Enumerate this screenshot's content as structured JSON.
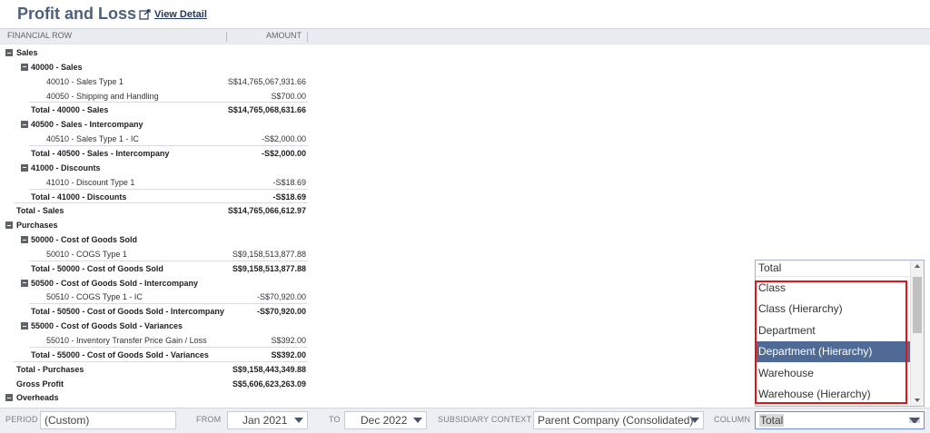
{
  "header": {
    "title": "Profit and Loss",
    "view_detail_label": "View Detail"
  },
  "table": {
    "col_financial_row": "FINANCIAL ROW",
    "col_amount": "AMOUNT"
  },
  "rows": [
    {
      "label": "Sales",
      "amount": "",
      "level": 0,
      "bold": true,
      "toggle": true
    },
    {
      "label": "40000 - Sales",
      "amount": "",
      "level": 1,
      "bold": true,
      "toggle": true
    },
    {
      "label": "40010 - Sales Type 1",
      "amount": "S$14,765,067,931.66",
      "level": 2,
      "bold": false
    },
    {
      "label": "40050 - Shipping and Handling",
      "amount": "S$700.00",
      "level": 2,
      "bold": false
    },
    {
      "label": "Total - 40000 - Sales",
      "amount": "S$14,765,068,631.66",
      "level": 1,
      "bold": true,
      "total": true
    },
    {
      "label": "40500 - Sales - Intercompany",
      "amount": "",
      "level": 1,
      "bold": true,
      "toggle": true
    },
    {
      "label": "40510 - Sales Type 1 - IC",
      "amount": "-S$2,000.00",
      "level": 2,
      "bold": false
    },
    {
      "label": "Total - 40500 - Sales - Intercompany",
      "amount": "-S$2,000.00",
      "level": 1,
      "bold": true,
      "total": true
    },
    {
      "label": "41000 - Discounts",
      "amount": "",
      "level": 1,
      "bold": true,
      "toggle": true
    },
    {
      "label": "41010 - Discount Type 1",
      "amount": "-S$18.69",
      "level": 2,
      "bold": false
    },
    {
      "label": "Total - 41000 - Discounts",
      "amount": "-S$18.69",
      "level": 1,
      "bold": true,
      "total": true
    },
    {
      "label": "Total - Sales",
      "amount": "S$14,765,066,612.97",
      "level": 0,
      "bold": true,
      "total": true
    },
    {
      "label": "Purchases",
      "amount": "",
      "level": 0,
      "bold": true,
      "toggle": true
    },
    {
      "label": "50000 - Cost of Goods Sold",
      "amount": "",
      "level": 1,
      "bold": true,
      "toggle": true
    },
    {
      "label": "50010 - COGS Type 1",
      "amount": "S$9,158,513,877.88",
      "level": 2,
      "bold": false
    },
    {
      "label": "Total - 50000 - Cost of Goods Sold",
      "amount": "S$9,158,513,877.88",
      "level": 1,
      "bold": true,
      "total": true
    },
    {
      "label": "50500 - Cost of Goods Sold - Intercompany",
      "amount": "",
      "level": 1,
      "bold": true,
      "toggle": true
    },
    {
      "label": "50510 - COGS Type 1 - IC",
      "amount": "-S$70,920.00",
      "level": 2,
      "bold": false
    },
    {
      "label": "Total - 50500 - Cost of Goods Sold - Intercompany",
      "amount": "-S$70,920.00",
      "level": 1,
      "bold": true,
      "total": true
    },
    {
      "label": "55000 - Cost of Goods Sold - Variances",
      "amount": "",
      "level": 1,
      "bold": true,
      "toggle": true
    },
    {
      "label": "55010 - Inventory Transfer Price Gain / Loss",
      "amount": "S$392.00",
      "level": 2,
      "bold": false
    },
    {
      "label": "Total - 55000 - Cost of Goods Sold - Variances",
      "amount": "S$392.00",
      "level": 1,
      "bold": true,
      "total": true
    },
    {
      "label": "Total - Purchases",
      "amount": "S$9,158,443,349.88",
      "level": 0,
      "bold": true,
      "total": true
    },
    {
      "label": "Gross Profit",
      "amount": "S$5,606,623,263.09",
      "level": 0,
      "bold": true
    },
    {
      "label": "Overheads",
      "amount": "",
      "level": 0,
      "bold": true,
      "toggle": true
    }
  ],
  "footer": {
    "period_label": "PERIOD",
    "period_value": "(Custom)",
    "from_label": "FROM",
    "from_value": "Jan 2021",
    "to_label": "TO",
    "to_value": "Dec 2022",
    "subsidiary_label": "SUBSIDIARY CONTEXT",
    "subsidiary_value": "Parent Company (Consolidated)",
    "column_label": "COLUMN",
    "column_value": "Total"
  },
  "dropdown": {
    "current": "Total",
    "options": [
      "Class",
      "Class (Hierarchy)",
      "Department",
      "Department (Hierarchy)",
      "Warehouse",
      "Warehouse (Hierarchy)"
    ],
    "active_index": 3
  },
  "colors": {
    "title": "#4d5f79",
    "highlight": "#e0151a",
    "active_option": "#4f6b95"
  }
}
